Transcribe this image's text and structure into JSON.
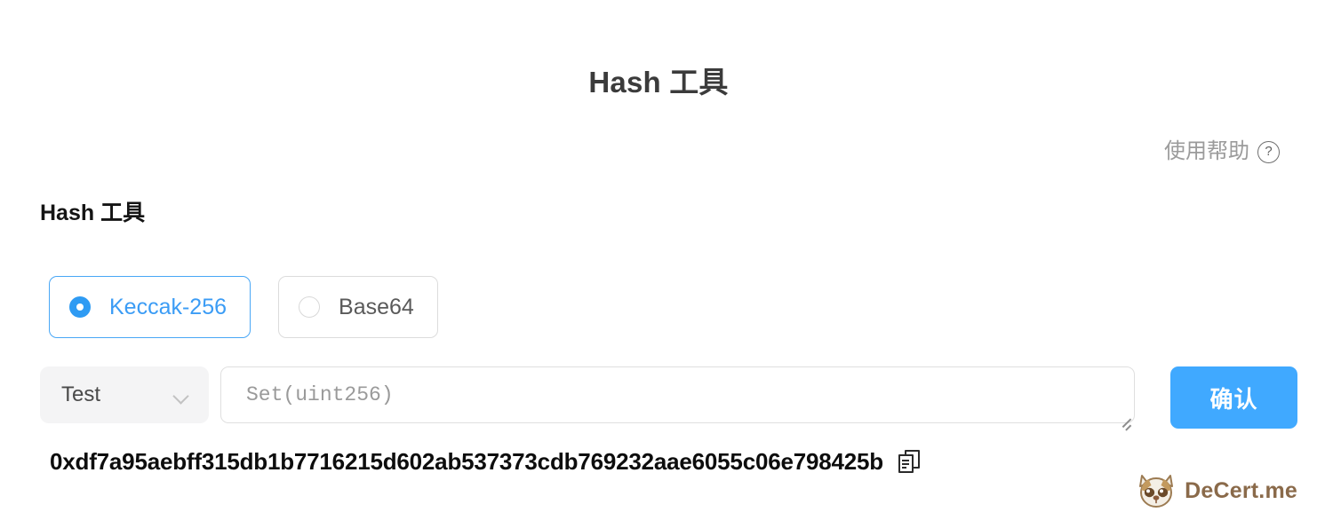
{
  "page": {
    "title": "Hash 工具",
    "background_color": "#ffffff"
  },
  "help": {
    "label": "使用帮助",
    "icon": "question-circle-icon"
  },
  "section": {
    "heading": "Hash 工具"
  },
  "algorithm_options": [
    {
      "label": "Keccak-256",
      "selected": true,
      "icon": "radio-selected-icon"
    },
    {
      "label": "Base64",
      "selected": false,
      "icon": "radio-unselected-icon"
    }
  ],
  "form": {
    "select": {
      "value": "Test",
      "icon": "chevron-down-icon"
    },
    "input": {
      "placeholder": "Set(uint256)",
      "value": "",
      "resize_handle": "resize-grip-icon"
    },
    "submit": {
      "label": "确认"
    }
  },
  "result": {
    "hash": "0xdf7a95aebff315db1b7716215d602ab537373cdb769232aae6055c06e798425b",
    "copy_icon": "copy-icon"
  },
  "brand": {
    "name": "DeCert.me",
    "logo": "raccoon-mascot-icon"
  },
  "colors": {
    "accent_blue": "#40a9ff",
    "radio_blue": "#2f9bf3",
    "label_blue": "#3b9cf5",
    "muted_gray": "#9b9b9b",
    "brand_brown": "#8a6a4a"
  }
}
